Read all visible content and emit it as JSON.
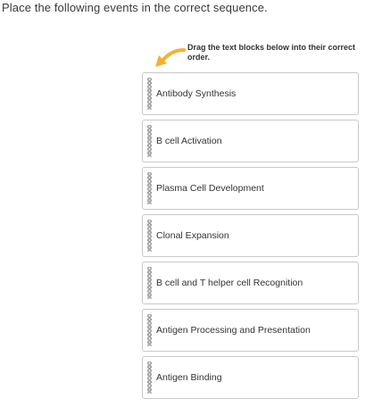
{
  "question": {
    "text": "Place the following events in the correct sequence."
  },
  "hint": {
    "text": "Drag the text blocks below into their correct order.",
    "arrow_icon": "curved-arrow-icon",
    "arrow_color": "#f2b233"
  },
  "blocks": [
    {
      "label": "Antibody Synthesis"
    },
    {
      "label": "B cell Activation"
    },
    {
      "label": "Plasma Cell Development"
    },
    {
      "label": "Clonal Expansion"
    },
    {
      "label": "B cell and T helper cell Recognition"
    },
    {
      "label": "Antigen Processing and Presentation"
    },
    {
      "label": "Antigen Binding"
    }
  ]
}
